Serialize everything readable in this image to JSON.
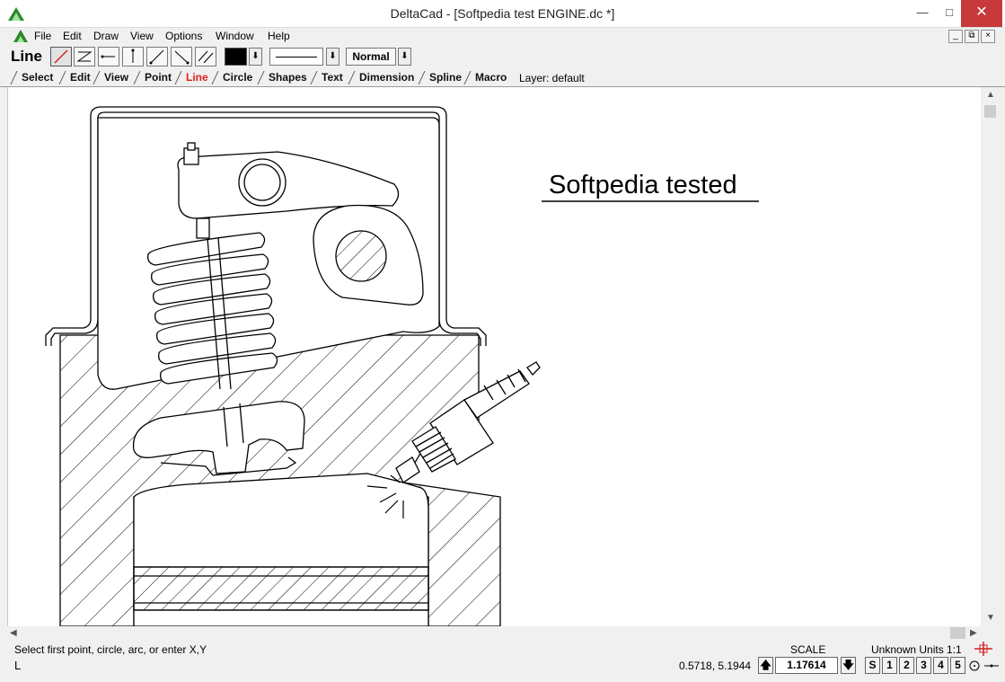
{
  "window": {
    "title": "DeltaCad - [Softpedia test ENGINE.dc *]"
  },
  "menu": {
    "items": [
      "File",
      "Edit",
      "Draw",
      "View",
      "Options",
      "Window",
      "Help"
    ]
  },
  "toolbar": {
    "tool_name": "Line",
    "mode": "Normal"
  },
  "tabs": [
    "Select",
    "Edit",
    "View",
    "Point",
    "Line",
    "Circle",
    "Shapes",
    "Text",
    "Dimension",
    "Spline",
    "Macro"
  ],
  "active_tab": "Line",
  "layer_label": "Layer: default",
  "drawing": {
    "annotation": "Softpedia tested"
  },
  "status": {
    "prompt": "Select first point, circle, arc, or enter X,Y",
    "prompt_cursor": "L",
    "scale_label": "SCALE",
    "units_label": "Unknown Units 1:1",
    "coordinates": "0.5718, 5.1944",
    "scale_value": "1.17614",
    "snap_buttons": [
      "S",
      "1",
      "2",
      "3",
      "4",
      "5"
    ]
  },
  "colors": {
    "active_tab": "#e02020",
    "close_button": "#c7393a",
    "icon_green": "#2a8a2a"
  }
}
